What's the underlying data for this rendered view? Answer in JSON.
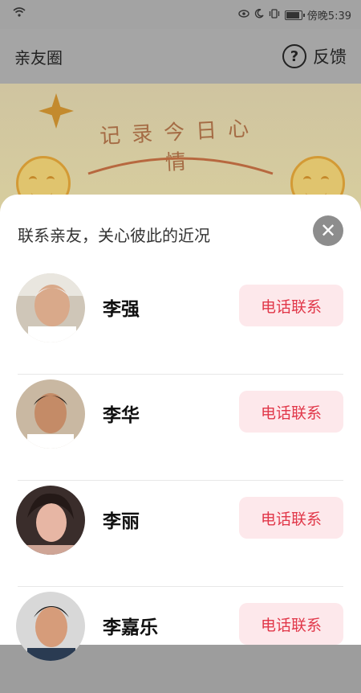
{
  "status": {
    "time": "傍晚5:39"
  },
  "appbar": {
    "title": "亲友圈",
    "feedback": "反馈",
    "help_symbol": "?"
  },
  "banner": {
    "text": "记录今日心情"
  },
  "sheet": {
    "title": "联系亲友，关心彼此的近况",
    "close_symbol": "✕",
    "contacts": [
      {
        "name": "李强",
        "call_label": "电话联系"
      },
      {
        "name": "李华",
        "call_label": "电话联系"
      },
      {
        "name": "李丽",
        "call_label": "电话联系"
      },
      {
        "name": "李嘉乐",
        "call_label": "电话联系"
      }
    ]
  },
  "colors": {
    "accent": "#e13749",
    "button_bg": "#fde8eb",
    "overlay": "#9d9d9d"
  }
}
